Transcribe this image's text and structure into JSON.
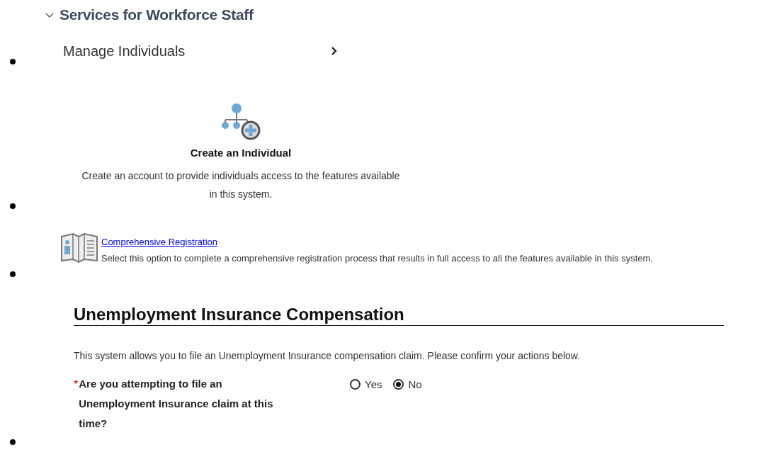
{
  "section": {
    "title": "Services for Workforce Staff",
    "expanded": true
  },
  "items": [
    {
      "kind": "menu",
      "label": "Manage Individuals"
    },
    {
      "kind": "tile",
      "title": "Create an Individual",
      "description": "Create an account to provide individuals access to the features available in this system."
    },
    {
      "kind": "link",
      "label": "Comprehensive Registration",
      "description": "Select this option to complete a comprehensive registration process that results in full access to all the features available in this system."
    },
    {
      "kind": "question",
      "heading": "Unemployment Insurance Compensation",
      "intro": "This system allows you to file an Unemployment Insurance compensation claim. Please confirm your actions below.",
      "required": true,
      "required_marker": "*",
      "question": "Are you attempting to file an Unemployment Insurance claim at this time?",
      "options": [
        {
          "label": "Yes",
          "selected": false
        },
        {
          "label": "No",
          "selected": true
        }
      ]
    }
  ]
}
